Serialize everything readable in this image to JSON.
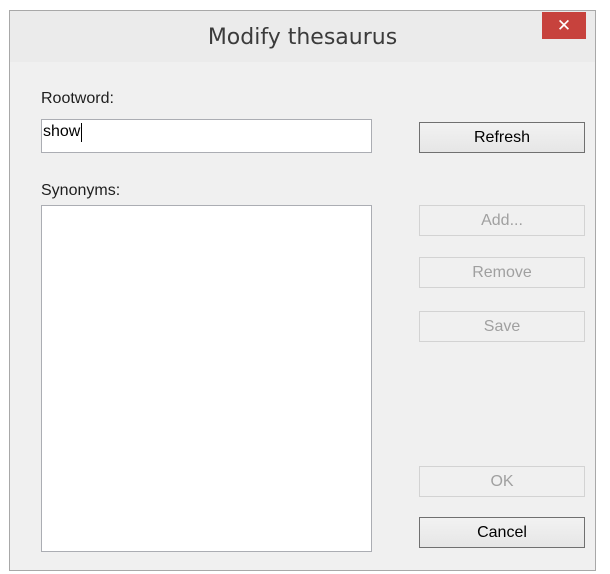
{
  "window": {
    "title": "Modify thesaurus",
    "close_glyph": "✕"
  },
  "rootword": {
    "label": "Rootword:",
    "value": "show"
  },
  "synonyms": {
    "label": "Synonyms:",
    "items": []
  },
  "buttons": {
    "refresh": "Refresh",
    "add": "Add...",
    "remove": "Remove",
    "save": "Save",
    "ok": "OK",
    "cancel": "Cancel"
  },
  "icons": {
    "close": "close-icon"
  },
  "colors": {
    "close_button": "#c7423d",
    "dialog_bg": "#f0f0f0",
    "disabled_text": "#a0a0a0"
  }
}
